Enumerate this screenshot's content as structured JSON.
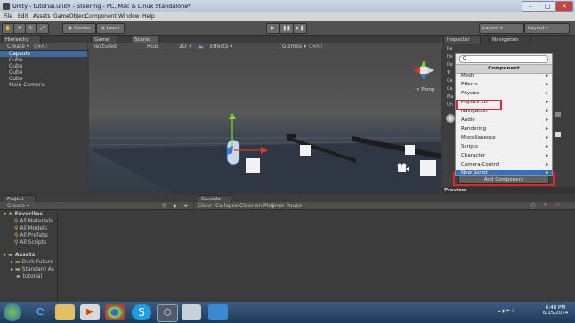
{
  "window": {
    "title": "Unity - tutorial.unity - Steering - PC, Mac & Linux Standalone*"
  },
  "menubar": [
    "File",
    "Edit",
    "Assets",
    "GameObject",
    "Component",
    "Window",
    "Help"
  ],
  "toolbar": {
    "pivot": "Center",
    "space": "Local",
    "layers": "Layers",
    "layout": "Layout"
  },
  "hierarchy": {
    "tab": "Hierarchy",
    "create": "Create ▾",
    "search": "Q▾All",
    "items": [
      "Capsule",
      "Cube",
      "Cube",
      "Cube",
      "Cube",
      "Main Camera"
    ]
  },
  "game_tab": "Game",
  "scene_tab": "Scene",
  "scene_toolbar": {
    "shading": "Textured",
    "rgb": "RGB",
    "mode2d": "2D",
    "effects": "Effects ▾",
    "gizmos": "Gizmos ▾",
    "search": "Q▾All"
  },
  "gizmo_label": "< Persp",
  "inspector": {
    "tab": "Inspector",
    "nav_tab": "Navigation",
    "rows": [
      "Ra",
      "He",
      "De",
      "Tr",
      "Ca",
      "Ca",
      "Ma",
      "Un"
    ],
    "preview": "Preview",
    "add_component": "Add Component"
  },
  "component_menu": {
    "search": "Q",
    "header": "Component",
    "items": [
      "Mesh",
      "Effects",
      "Physics",
      "Physics 2D",
      "Navigation",
      "Audio",
      "Rendering",
      "Miscellaneous",
      "Scripts",
      "Character",
      "Camera-Control",
      "New Script"
    ],
    "selected": "New Script",
    "highlighted": "Navigation"
  },
  "project": {
    "tab": "Project",
    "create": "Create ▾",
    "favorites": "Favorites",
    "fav_items": [
      "All Materials",
      "All Models",
      "All Prefabs",
      "All Scripts"
    ],
    "assets": "Assets",
    "asset_items": [
      "Dark Future",
      "Standard As",
      "tutorial"
    ]
  },
  "console": {
    "tab": "Console",
    "buttons": [
      "Clear",
      "Collapse",
      "Clear on Play",
      "Error Pause"
    ]
  },
  "taskbar": {
    "time": "6:48 PM",
    "date": "6/15/2014"
  }
}
